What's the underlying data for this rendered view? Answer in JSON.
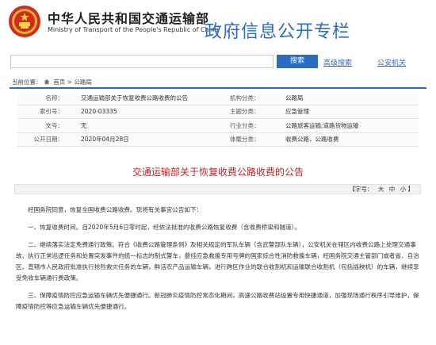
{
  "header": {
    "site_name_cn": "中华人民共和国交通运输部",
    "site_name_en": "Ministry of Transport of the People's Republic of China",
    "column_title": "政府信息公开专栏"
  },
  "search": {
    "input_value": "",
    "button_label": "搜索",
    "advanced_label": "高级搜索",
    "public_label": "公安机关"
  },
  "breadcrumb": {
    "prefix": "当前位置：",
    "home": "首页",
    "sep": " > ",
    "section": "公路局"
  },
  "meta": {
    "rows": [
      {
        "k1": "名称：",
        "v1": "交通运输部关于恢复收费公路收费的公告",
        "k2": "机构分类：",
        "v2": "公路局"
      },
      {
        "k1": "索引号：",
        "v1": "2020-03335",
        "k2": "主题分类：",
        "v2": "应急管理"
      },
      {
        "k1": "文号：",
        "v1": "无",
        "k2": "行业分类：",
        "v2": "公路旅客运输;道路货物运输"
      },
      {
        "k1": "公开日期：",
        "v1": "2020年04月28日",
        "k2": "体载分类：",
        "v2": "收费公路，公路收费"
      }
    ]
  },
  "document": {
    "title": "交通运输部关于恢复收费公路收费的公告",
    "font_size_label": "【字号：",
    "font_sizes": [
      "大",
      "中",
      "小"
    ],
    "font_size_close": "】",
    "paragraphs": [
      "经国务院同意，恢复全国收费公路收费。现将有关事宜公告如下：",
      "一、恢复收费时间。自2020年5月6日零时起，经依法批准的收费公路恢复收费（含收费桥梁和隧道）。",
      "二、继续落实法定免费通行政策。符合《收费公路管理条例》及相关规定的军队车辆（含武警部队车辆），公安机关在辖区内收费公路上处理交通事故、执行正常巡逻任务和处置突发事件的统一标志的制式警车，悬挂应急救援专用号牌的国家综合性消防救援车辆，经国务院交通主管部门或者省、自治区、直辖市人民政府批准执行抢险救灾任务的车辆，鲜活农产品运输车辆，进行跨区作业的联合收割机和运输联合收割机（包括插秧机）的车辆，继续享受免收车辆通行费政策。",
      "三、保障疫情防控应急运输车辆优先便捷通行。新冠肺炎疫情防控常态化期间，高速公路收费站设置专用快捷通道，加强现场通行秩序引导维护，保障疫情防控等应急运输车辆优先便捷通行。"
    ]
  },
  "colors": {
    "accent_blue": "#2a6cc4",
    "title_red": "#c81e1e"
  }
}
